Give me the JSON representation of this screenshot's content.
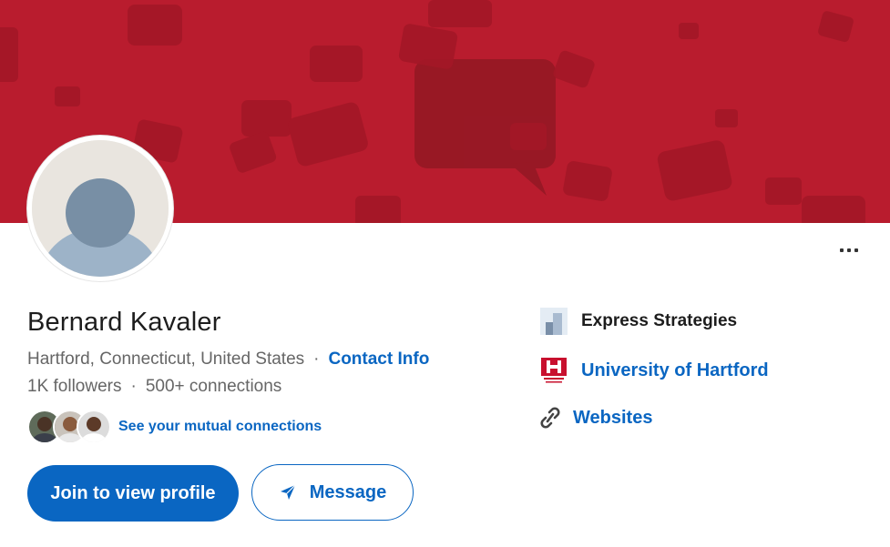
{
  "profile": {
    "name": "Bernard Kavaler",
    "location": "Hartford, Connecticut, United States",
    "separator": "·",
    "contact_info_label": "Contact Info",
    "followers": "1K followers",
    "connections": "500+ connections",
    "mutual_connections_label": "See your mutual connections"
  },
  "actions": {
    "join_label": "Join to view profile",
    "message_label": "Message"
  },
  "sidebar": {
    "company": "Express Strategies",
    "school": "University of Hartford",
    "websites": "Websites"
  },
  "colors": {
    "banner": "#b91c2e",
    "accent": "#0a66c2",
    "text": "#1d1d1d",
    "muted": "#666666"
  },
  "icons": [
    "banner-speech-bubbles",
    "default-avatar-icon",
    "more-options-icon",
    "send-icon",
    "express-strategies-logo",
    "university-of-hartford-logo",
    "link-icon"
  ]
}
